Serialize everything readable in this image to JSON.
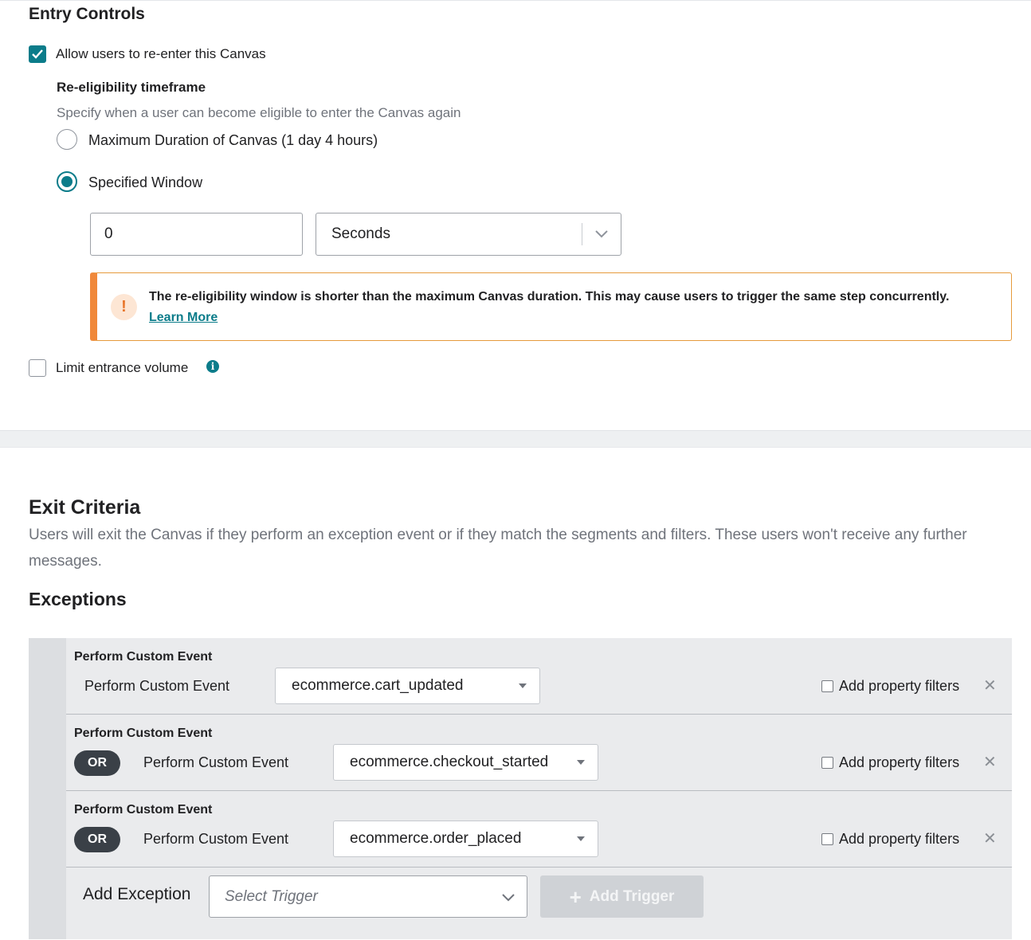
{
  "entry_controls": {
    "title": "Entry Controls",
    "allow_reenter_label": "Allow users to re-enter this Canvas",
    "allow_reenter_checked": true,
    "reeligibility_title": "Re-eligibility timeframe",
    "reeligibility_hint": "Specify when a user can become eligible to enter the Canvas again",
    "option_max_duration": "Maximum Duration of Canvas (1 day 4 hours)",
    "option_specified_window": "Specified Window",
    "selected_option": "Specified Window",
    "window_value": "0",
    "window_unit": "Seconds",
    "warning_text": "The re-eligibility window is shorter than the maximum Canvas duration. This may cause users to trigger the same step concurrently.",
    "warning_link": "Learn More",
    "warning_icon_glyph": "!",
    "limit_volume_label": "Limit entrance volume",
    "limit_volume_checked": false,
    "info_icon_glyph": "i"
  },
  "exit_criteria": {
    "title": "Exit Criteria",
    "description": "Users will exit the Canvas if they perform an exception event or if they match the segments and filters. These users won't receive any further messages.",
    "exceptions_title": "Exceptions",
    "exceptions": [
      {
        "heading": "Perform Custom Event",
        "connector": "",
        "label": "Perform Custom Event",
        "event": "ecommerce.cart_updated",
        "filter_label": "Add property filters",
        "remove": "✕"
      },
      {
        "heading": "Perform Custom Event",
        "connector": "OR",
        "label": "Perform Custom Event",
        "event": "ecommerce.checkout_started",
        "filter_label": "Add property filters",
        "remove": "✕"
      },
      {
        "heading": "Perform Custom Event",
        "connector": "OR",
        "label": "Perform Custom Event",
        "event": "ecommerce.order_placed",
        "filter_label": "Add property filters",
        "remove": "✕"
      }
    ],
    "add_exception_label": "Add Exception",
    "select_trigger_placeholder": "Select Trigger",
    "add_trigger_label": "Add Trigger",
    "add_trigger_plus": "+"
  },
  "colors": {
    "accent": "#0b7c8a",
    "warning_border": "#f0883a",
    "pill": "#3a4047"
  }
}
